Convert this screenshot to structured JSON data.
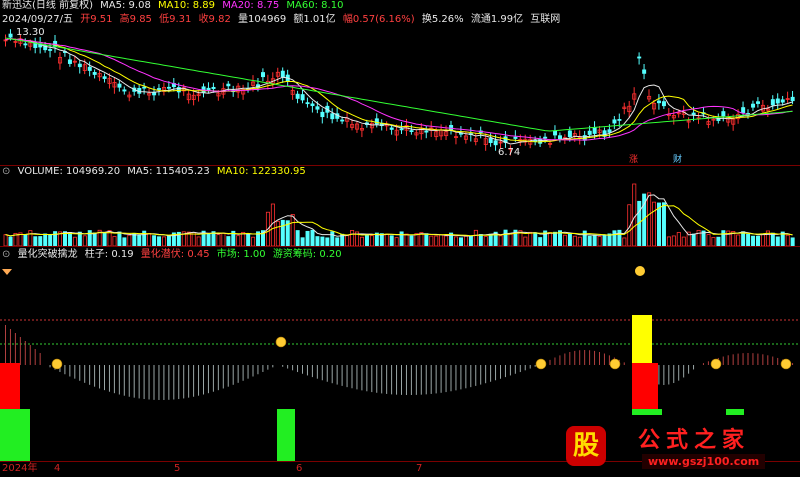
{
  "pane1": {
    "title": "新迅达(日线 前复权)",
    "ma": [
      {
        "label": "MA5: 9.08",
        "color": "#e8e8e8"
      },
      {
        "label": "MA10: 8.89",
        "color": "#ffff00"
      },
      {
        "label": "MA20: 8.75",
        "color": "#ff33ff"
      },
      {
        "label": "MA60: 8.10",
        "color": "#33ff33"
      }
    ],
    "info": [
      {
        "text": "2024/09/27/五",
        "color": "#e8e8e8"
      },
      {
        "text": "开9.51",
        "color": "#ff4040"
      },
      {
        "text": "高9.85",
        "color": "#ff4040"
      },
      {
        "text": "低9.31",
        "color": "#ff4040"
      },
      {
        "text": "收9.82",
        "color": "#ff4040"
      },
      {
        "text": "量104969",
        "color": "#e8e8e8"
      },
      {
        "text": "额1.01亿",
        "color": "#e8e8e8"
      },
      {
        "text": "幅0.57(6.16%)",
        "color": "#ff4040"
      },
      {
        "text": "换5.26%",
        "color": "#e8e8e8"
      },
      {
        "text": "流通1.99亿",
        "color": "#e8e8e8"
      },
      {
        "text": "互联网",
        "color": "#e8e8e8"
      }
    ],
    "high_label": "13.30",
    "low_label": "6.74",
    "badge_zhang": "涨",
    "badge_cai": "财"
  },
  "pane2": {
    "indicator": [
      {
        "text": "VOLUME: 104969.20",
        "color": "#e8e8e8"
      },
      {
        "text": "MA5: 115405.23",
        "color": "#e8e8e8"
      },
      {
        "text": "MA10: 122330.95",
        "color": "#ffff00"
      }
    ]
  },
  "pane3": {
    "indicator": [
      {
        "text": "量化突破擒龙",
        "color": "#e8e8e8"
      },
      {
        "text": "柱子: 0.19",
        "color": "#e8e8e8"
      },
      {
        "text": "量化潜伏: 0.45",
        "color": "#ff4040"
      },
      {
        "text": "市场: 1.00",
        "color": "#33ff33"
      },
      {
        "text": "游资筹码: 0.20",
        "color": "#33ff33"
      }
    ]
  },
  "x_axis": [
    {
      "label": "2024年",
      "month": 0
    },
    {
      "label": "4",
      "month": 4
    },
    {
      "label": "5",
      "month": 5
    },
    {
      "label": "6",
      "month": 6
    },
    {
      "label": "7",
      "month": 7
    }
  ],
  "watermark": {
    "logo_text": "股",
    "title": "公式之家",
    "url": "www.gszj100.com"
  },
  "colors": {
    "up": "#ff3030",
    "down": "#55ffff",
    "ma5": "#e8e8e8",
    "ma10": "#ffff00",
    "ma20": "#ff33ff",
    "ma60": "#33ff33"
  }
}
